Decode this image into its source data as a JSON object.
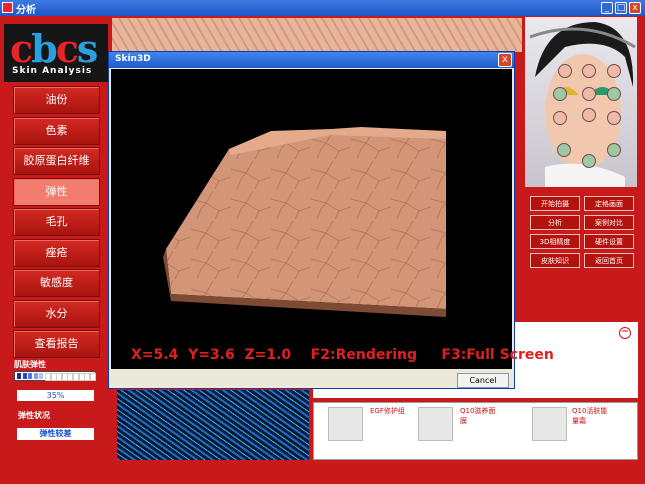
{
  "window": {
    "title": "分析",
    "min": "_",
    "max": "□",
    "close": "x"
  },
  "logo": {
    "letters": "cbcs",
    "subtitle": "Skin Analysis"
  },
  "menu": [
    {
      "label": "油份"
    },
    {
      "label": "色素"
    },
    {
      "label": "胶原蛋白纤维"
    },
    {
      "label": "弹性",
      "active": true
    },
    {
      "label": "毛孔"
    },
    {
      "label": "痤疮"
    },
    {
      "label": "敏感度"
    },
    {
      "label": "水分"
    },
    {
      "label": "查看报告"
    }
  ],
  "elasticity": {
    "heading": "肌肤弹性",
    "value": "35%",
    "level": 0.35,
    "status_heading": "弹性状况",
    "status": "弹性较差"
  },
  "right_buttons": [
    {
      "label": "开始拍摄"
    },
    {
      "label": "定格画面"
    },
    {
      "label": "分析"
    },
    {
      "label": "案例对比"
    },
    {
      "label": "3D相精度"
    },
    {
      "label": "硬件设置"
    },
    {
      "label": "皮肤知识"
    },
    {
      "label": "返回首页"
    }
  ],
  "products": [
    {
      "label": "EGF修护组"
    },
    {
      "label": "Q10滋养面膜"
    },
    {
      "label": "Q10活肤能量霜"
    }
  ],
  "dialog": {
    "title": "Skin3D",
    "close": "x",
    "readout": "X=5.4  Y=3.6  Z=1.0    F2:Rendering     F3:Full Screen",
    "cancel": "Cancel"
  },
  "info_panel": {
    "collapse": "−"
  },
  "colors": {
    "brand_red": "#c81a1a",
    "button_red": "#b3120d",
    "title_blue": "#1f57c8",
    "readout_red": "#e02020"
  },
  "icons": [
    "app-icon",
    "minimize-icon",
    "maximize-icon",
    "close-icon",
    "collapse-icon",
    "product-image"
  ]
}
